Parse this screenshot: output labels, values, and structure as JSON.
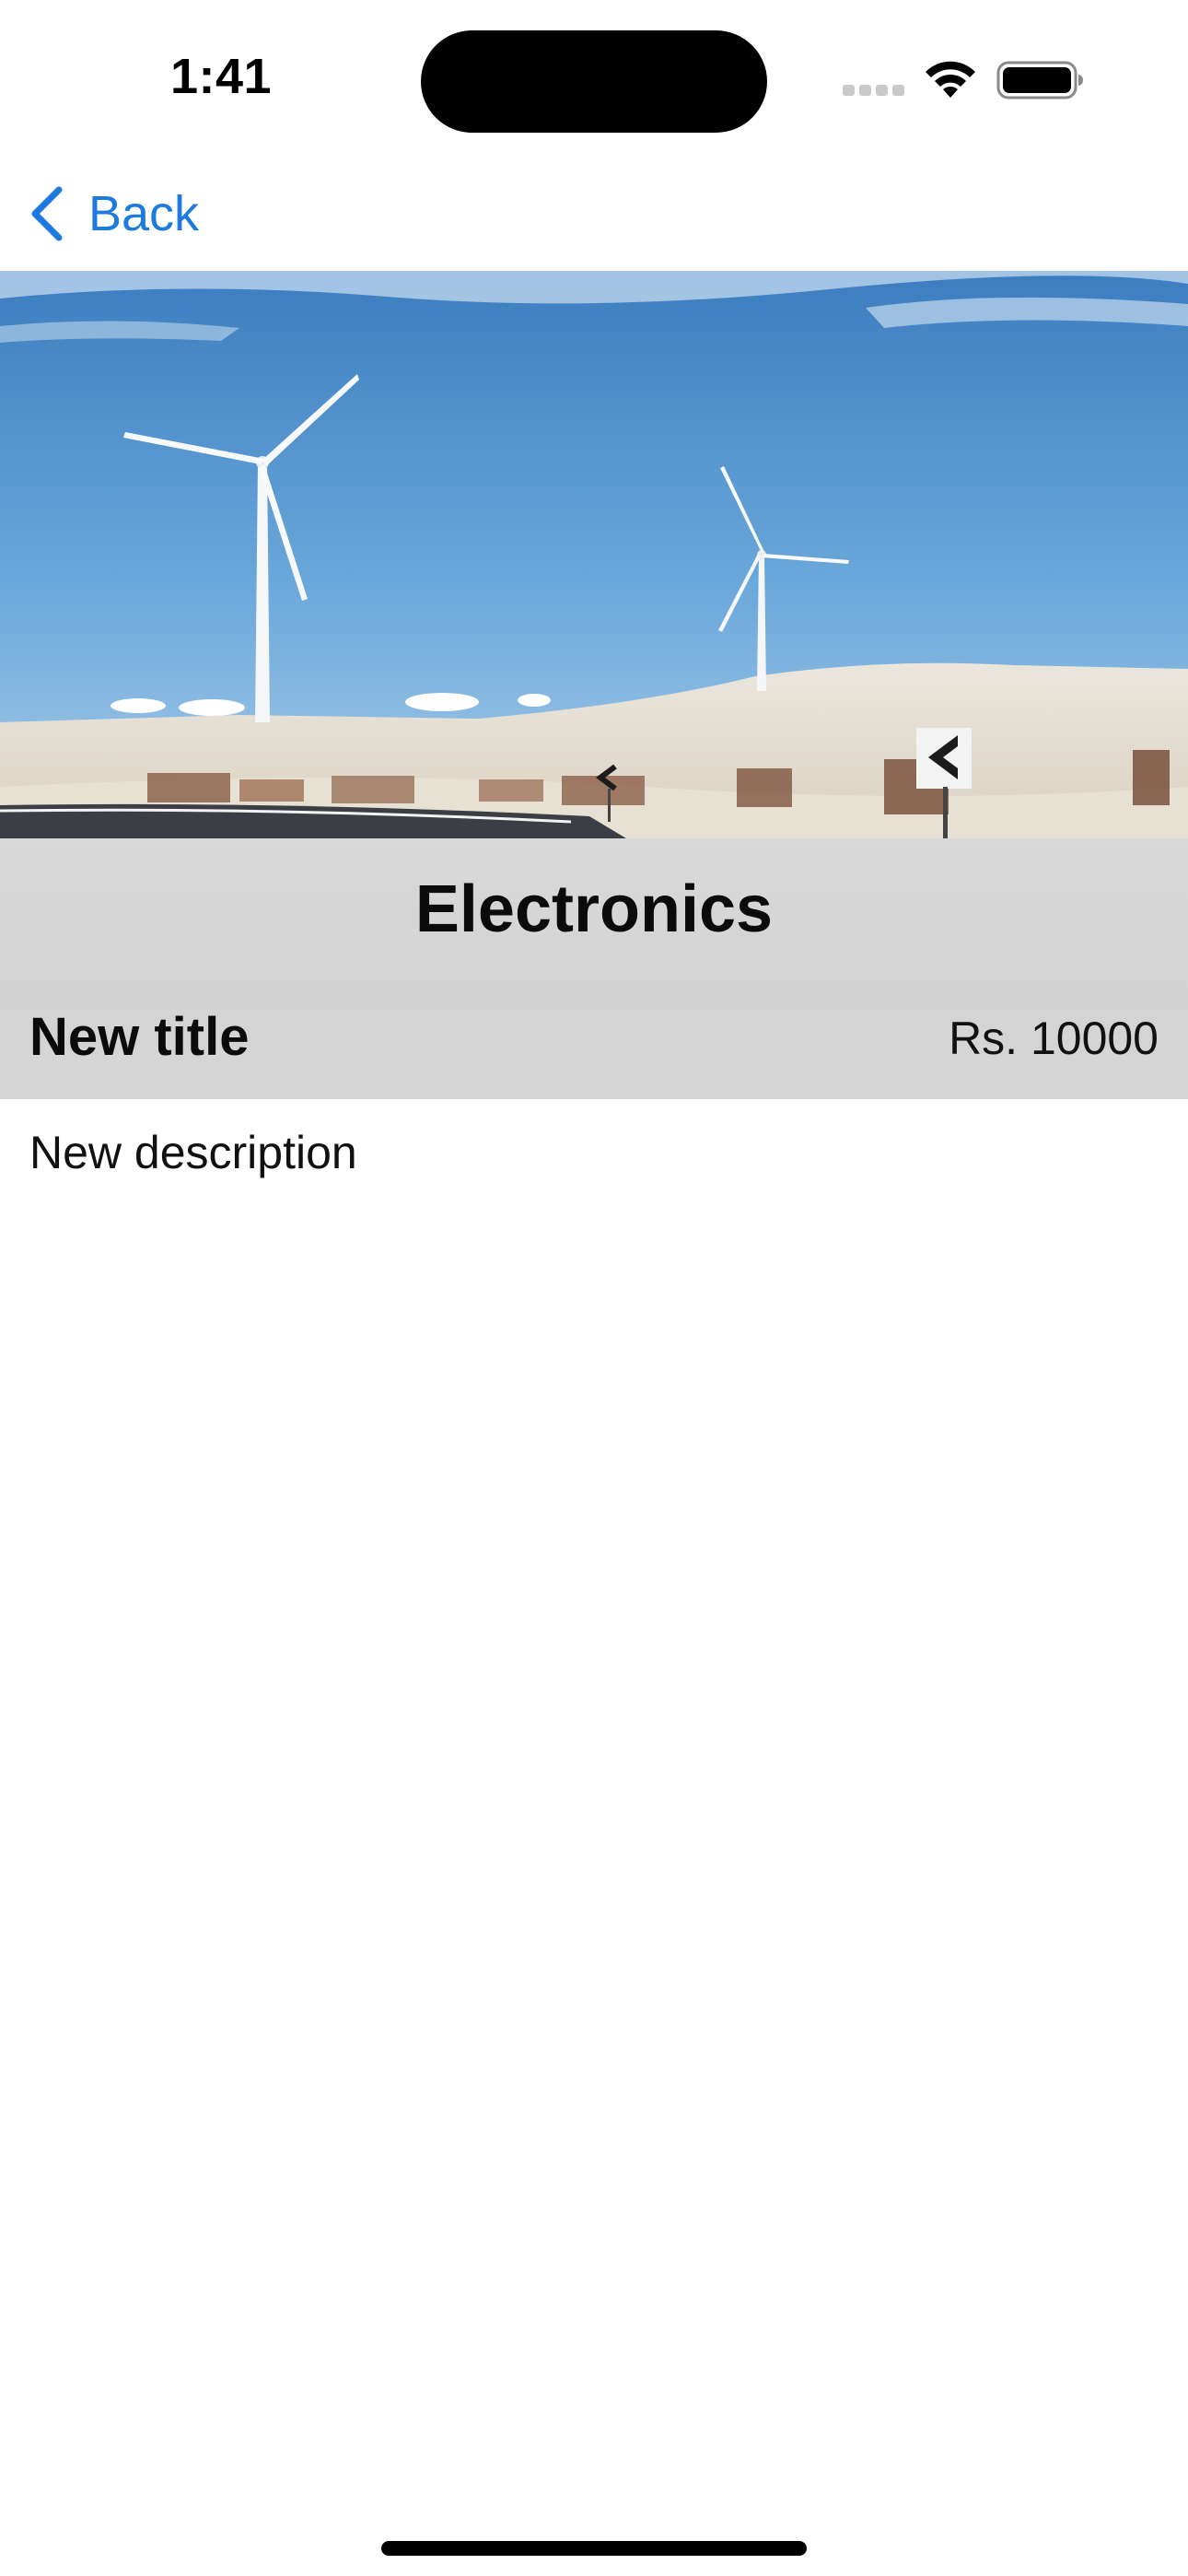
{
  "status_bar": {
    "time": "1:41",
    "icons": [
      "cellular-signal-icon",
      "wifi-icon",
      "battery-icon"
    ]
  },
  "nav": {
    "back_label": "Back",
    "back_icon": "chevron-left-icon",
    "accent_color": "#1f7ae0"
  },
  "hero_image": {
    "subject": "wind-turbines-photo"
  },
  "product": {
    "category": "Electronics",
    "title": "New title",
    "price": "Rs. 10000",
    "description": "New description"
  }
}
